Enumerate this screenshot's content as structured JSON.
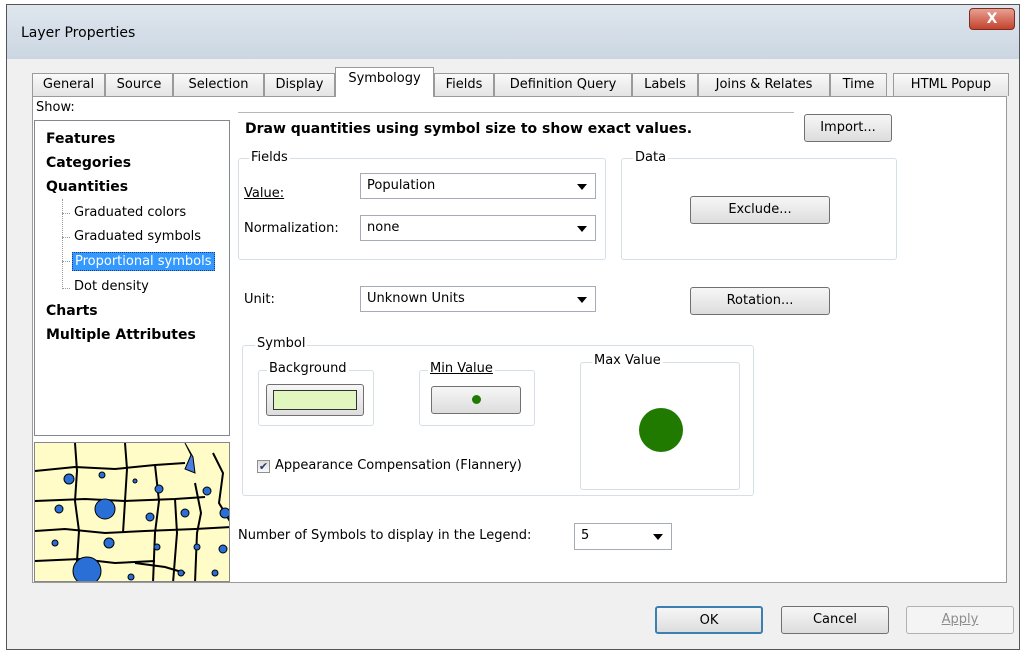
{
  "window": {
    "title": "Layer Properties",
    "close_glyph": "X"
  },
  "tabs": [
    {
      "label": "General"
    },
    {
      "label": "Source"
    },
    {
      "label": "Selection"
    },
    {
      "label": "Display"
    },
    {
      "label": "Symbology",
      "active": true
    },
    {
      "label": "Fields"
    },
    {
      "label": "Definition Query"
    },
    {
      "label": "Labels"
    },
    {
      "label": "Joins & Relates"
    },
    {
      "label": "Time"
    },
    {
      "label": "HTML Popup"
    }
  ],
  "show": {
    "label": "Show:",
    "items": {
      "features": "Features",
      "categories": "Categories",
      "quantities": "Quantities",
      "graduated_colors": "Graduated colors",
      "graduated_symbols": "Graduated symbols",
      "proportional_symbols": "Proportional symbols",
      "dot_density": "Dot density",
      "charts": "Charts",
      "multiple_attributes": "Multiple Attributes"
    },
    "selected": "Proportional symbols"
  },
  "description": "Draw quantities using symbol size to show exact values.",
  "import_button": "Import...",
  "fields": {
    "group_title": "Fields",
    "value_label": "Value:",
    "value": "Population",
    "normalization_label": "Normalization:",
    "normalization": "none"
  },
  "data": {
    "group_title": "Data",
    "exclude_button": "Exclude..."
  },
  "unit": {
    "label": "Unit:",
    "value": "Unknown Units"
  },
  "rotation_button": "Rotation...",
  "symbol": {
    "group_title": "Symbol",
    "background_title": "Background",
    "min_value_title": "Min Value",
    "max_value_title": "Max Value",
    "appearance_compensation": "Appearance Compensation (Flannery)",
    "appearance_checked": true
  },
  "legend": {
    "label": "Number of Symbols to display in the Legend:",
    "value": "5"
  },
  "footer": {
    "ok": "OK",
    "cancel": "Cancel",
    "apply": "Apply"
  },
  "colors": {
    "symbol_green": "#217a00",
    "background_swatch": "#e2f7c0",
    "map_fill": "#fffcc8",
    "map_dots": "#2a6fd6"
  }
}
